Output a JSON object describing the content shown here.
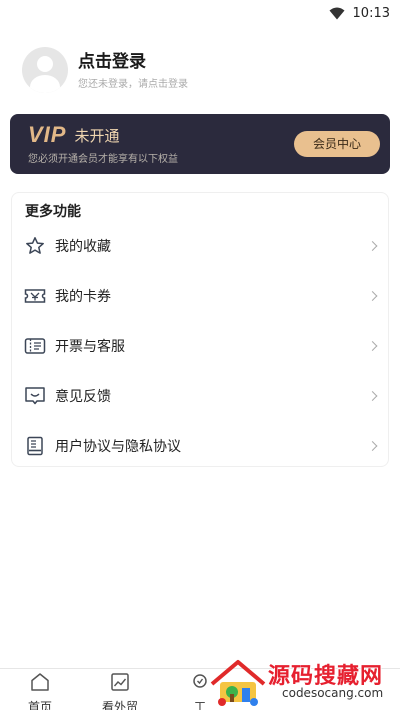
{
  "status": {
    "time": "10:13"
  },
  "profile": {
    "title": "点击登录",
    "subtitle": "您还未登录，请点击登录"
  },
  "vip": {
    "logo": "VIP",
    "status": "未开通",
    "description": "您必须开通会员才能享有以下权益",
    "button": "会员中心"
  },
  "features": {
    "title": "更多功能",
    "items": [
      {
        "label": "我的收藏",
        "icon": "star-icon"
      },
      {
        "label": "我的卡券",
        "icon": "ticket-icon"
      },
      {
        "label": "开票与客服",
        "icon": "invoice-icon"
      },
      {
        "label": "意见反馈",
        "icon": "feedback-icon"
      },
      {
        "label": "用户协议与隐私协议",
        "icon": "document-icon"
      }
    ]
  },
  "bottom_nav": {
    "items": [
      {
        "label": "首页",
        "icon": "home-icon"
      },
      {
        "label": "看外贸",
        "icon": "chart-icon"
      },
      {
        "label": "工",
        "icon": "tool-icon"
      }
    ]
  },
  "watermark": {
    "title": "源码搜藏网",
    "subtitle": "codesocang.com"
  }
}
